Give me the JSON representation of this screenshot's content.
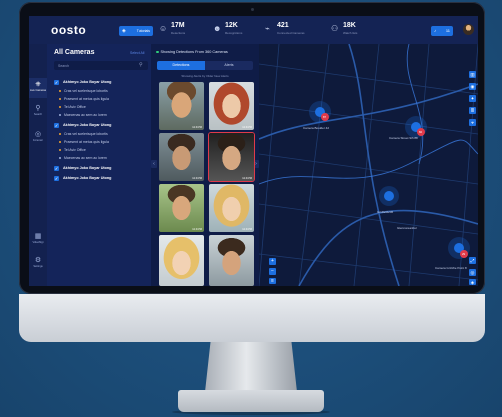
{
  "brand": "oosto",
  "header": {
    "tutorials_label": "Tutorials",
    "stats": [
      {
        "icon": "face-scan-icon",
        "value": "17M",
        "label": "Detections"
      },
      {
        "icon": "user-check-icon",
        "value": "12K",
        "label": "Recognitions"
      },
      {
        "icon": "cctv-camera-icon",
        "value": "421",
        "label": "Connected Cameras"
      },
      {
        "icon": "users-icon",
        "value": "18K",
        "label": "Watch lists"
      }
    ],
    "notifications_count": "11"
  },
  "nav": [
    {
      "icon": "camera-icon",
      "label": "Live Cameras",
      "active": true
    },
    {
      "icon": "search-icon",
      "label": "Search",
      "active": false
    },
    {
      "icon": "forensic-icon",
      "label": "Forensic",
      "active": false
    },
    {
      "icon": "video-icon",
      "label": "VideoMgt",
      "active": false
    },
    {
      "icon": "settings-icon",
      "label": "Settings",
      "active": false
    }
  ],
  "cameras": {
    "title": "All Cameras",
    "select_all": "Select All",
    "search_placeholder": "Search",
    "rows": [
      {
        "kind": "group",
        "label": "Akhimyo Joko Boyar Utong"
      },
      {
        "kind": "loc",
        "label": "Cras vel scelerisque lobortis",
        "color": "#f3a531"
      },
      {
        "kind": "loc",
        "label": "Praesent at metus quis ligula",
        "color": "#f3a531"
      },
      {
        "kind": "loc",
        "label": "Tel Aviv Office",
        "color": "#f3a531"
      },
      {
        "kind": "loc",
        "label": "Maecenas ac sem ac lorem",
        "color": "#9fb0dc"
      },
      {
        "kind": "group",
        "label": "Akhimyo Joko Boyar Utong"
      },
      {
        "kind": "loc",
        "label": "Cras vel scelerisque lobortis",
        "color": "#f3a531"
      },
      {
        "kind": "loc",
        "label": "Praesent at metus quis ligula",
        "color": "#f3a531"
      },
      {
        "kind": "loc",
        "label": "Tel Aviv Office",
        "color": "#f3a531"
      },
      {
        "kind": "loc",
        "label": "Maecenas ac sem ac lorem",
        "color": "#9fb0dc"
      },
      {
        "kind": "group",
        "label": "Akhimyo Joko Boyar Utong"
      },
      {
        "kind": "group",
        "label": "Akhimyo Joko Boyar Utong"
      }
    ]
  },
  "detections": {
    "header": "Showing Detections From 360 Cameras",
    "tabs": [
      "Detections",
      "Alerts"
    ],
    "subtitle": "Showing Alerts by Older New Alerts",
    "thumbs": [
      {
        "alert": false,
        "time": "12:44:56"
      },
      {
        "alert": false,
        "time": "12:44:56"
      },
      {
        "alert": false,
        "time": "12:44:56"
      },
      {
        "alert": true,
        "time": "12:44:56"
      },
      {
        "alert": false,
        "time": "12:44:56"
      },
      {
        "alert": false,
        "time": "12:44:56"
      },
      {
        "alert": false,
        "time": ""
      },
      {
        "alert": false,
        "time": ""
      }
    ]
  },
  "map": {
    "pins": [
      {
        "name": "Camera Boulder 42",
        "count": "87"
      },
      {
        "name": "Camera Street 9th 88",
        "count": "82"
      },
      {
        "name": "Gridfall4236",
        "count": ""
      },
      {
        "name": "Camera Grizzlie Point 8",
        "count": "29"
      }
    ],
    "labels": [
      "Glennoreanbur"
    ]
  },
  "colors": {
    "accent": "#1d6fe0",
    "alert": "#e03a4a",
    "background": "#0f1b3a"
  }
}
